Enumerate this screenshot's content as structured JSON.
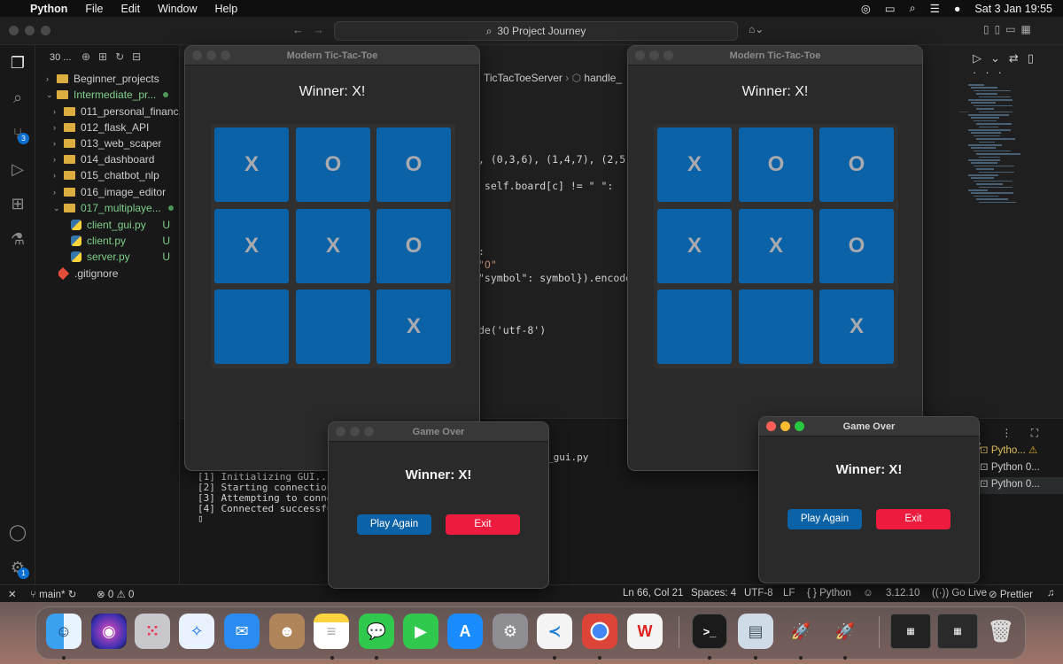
{
  "menubar": {
    "app": "Python",
    "items": [
      "File",
      "Edit",
      "Window",
      "Help"
    ],
    "datetime": "Sat 3 Jan  19:55"
  },
  "vscode": {
    "search": "30 Project Journey",
    "sidebar_title": "30 ...",
    "tree": [
      {
        "label": "Beginner_projects",
        "type": "folder"
      },
      {
        "label": "Intermediate_pr...",
        "type": "folder-open"
      },
      {
        "label": "011_personal_financ...",
        "type": "folder"
      },
      {
        "label": "012_flask_API",
        "type": "folder"
      },
      {
        "label": "013_web_scaper",
        "type": "folder"
      },
      {
        "label": "014_dashboard",
        "type": "folder"
      },
      {
        "label": "015_chatbot_nlp",
        "type": "folder"
      },
      {
        "label": "016_image_editor",
        "type": "folder"
      },
      {
        "label": "017_multiplaye...",
        "type": "folder-open"
      },
      {
        "label": "client_gui.py",
        "type": "py",
        "status": "U"
      },
      {
        "label": "client.py",
        "type": "py",
        "status": "U"
      },
      {
        "label": "server.py",
        "type": "py",
        "status": "U"
      },
      {
        "label": ".gitignore",
        "type": "git"
      }
    ],
    "breadcrumb": {
      "class": "TicTacToeServer",
      "method": "handle_"
    },
    "code": [
      ", (0,3,6), (1,4,7), (2,5,8),",
      " self.board[c] != \" \":",
      ":",
      "\"O\"",
      "\"symbol\": symbol}).encode('u",
      "de('utf-8')"
    ],
    "terminal": [
      "[1] Initializing GUI...",
      "[2] Starting connection th",
      "[3] Attempting to connect",
      "[4] Connected successfully",
      "_gui.py"
    ],
    "terminal_tabs": [
      "Pytho...",
      "Python 0...",
      "Python 0..."
    ],
    "badges": {
      "scm": "3",
      "settings": "1"
    },
    "status": {
      "branch": "main*",
      "errors": "0",
      "warnings": "0",
      "position": "Ln 66, Col 21",
      "spaces": "Spaces: 4",
      "encoding": "UTF-8",
      "eol": "LF",
      "language": "Python",
      "version": "3.12.10",
      "golive": "Go Live",
      "prettier": "Prettier"
    }
  },
  "game_window_1": {
    "title": "Modern Tic-Tac-Toe",
    "status": "Winner: X!",
    "board": [
      "X",
      "O",
      "O",
      "X",
      "X",
      "O",
      "",
      "",
      "X"
    ]
  },
  "game_window_2": {
    "title": "Modern Tic-Tac-Toe",
    "status": "Winner: X!",
    "board": [
      "X",
      "O",
      "O",
      "X",
      "X",
      "O",
      "",
      "",
      "X"
    ]
  },
  "dialog_1": {
    "title": "Game Over",
    "message": "Winner: X!",
    "play_again": "Play Again",
    "exit": "Exit"
  },
  "dialog_2": {
    "title": "Game Over",
    "message": "Winner: X!",
    "play_again": "Play Again",
    "exit": "Exit"
  },
  "colors": {
    "cell": "#0b62a6",
    "play_again": "#0b62a6",
    "exit": "#ed1b3d",
    "close": "#ff5f57",
    "minimize": "#febc2e",
    "zoom": "#28c840"
  },
  "dock": [
    "finder-icon",
    "siri-icon",
    "launchpad-icon",
    "safari-icon",
    "mail-icon",
    "contacts-icon",
    "notes-icon",
    "messages-icon",
    "facetime-icon",
    "app-store-icon",
    "system-settings-icon",
    "vscode-icon",
    "chrome-icon",
    "wps-icon",
    "terminal-icon",
    "preview-icon",
    "python-launcher-icon",
    "python-launcher-icon-2",
    "window-thumbnail",
    "trash-icon"
  ]
}
